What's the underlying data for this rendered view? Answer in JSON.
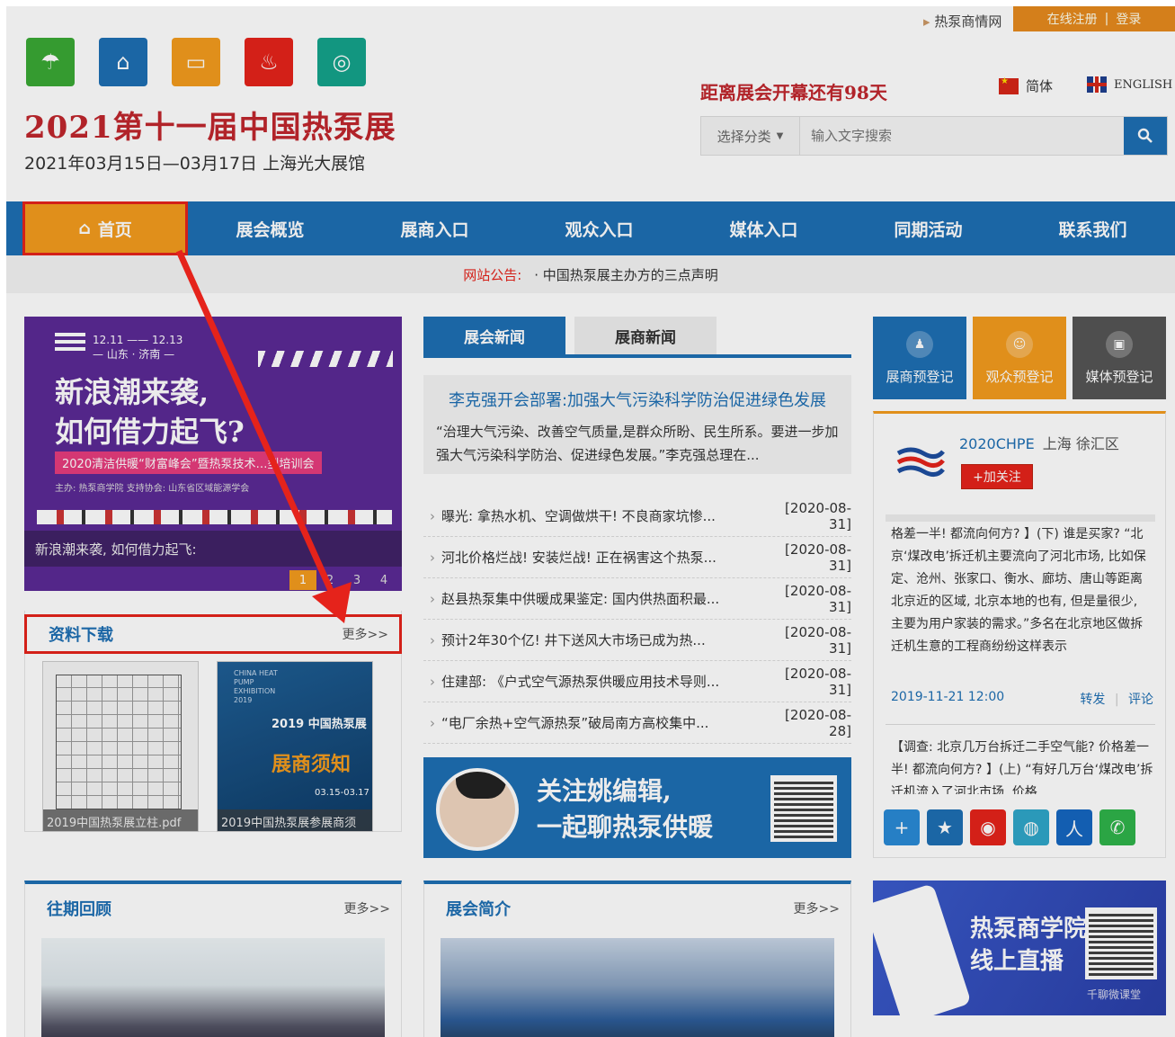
{
  "top": {
    "net_link": "热泵商情网",
    "register": "在线注册",
    "sep": "|",
    "login": "登录"
  },
  "logo_icons": [
    {
      "name": "umbrella-icon",
      "glyph": "☂",
      "color": "#3aa935"
    },
    {
      "name": "house-icon",
      "glyph": "⌂",
      "color": "#1e6fb4"
    },
    {
      "name": "card-icon",
      "glyph": "▭",
      "color": "#f49c1e"
    },
    {
      "name": "flame-icon",
      "glyph": "♨",
      "color": "#e5231b"
    },
    {
      "name": "link-icon",
      "glyph": "◎",
      "color": "#14a38b"
    }
  ],
  "header": {
    "title": "2021第十一届中国热泵展",
    "subtitle": "2021年03月15日—03月17日 上海光大展馆",
    "countdown": "距离展会开幕还有98天",
    "lang_cn": "简体",
    "lang_en": "ENGLISH"
  },
  "search": {
    "category": "选择分类",
    "placeholder": "输入文字搜索"
  },
  "nav": {
    "home": "首页",
    "items": [
      "展会概览",
      "展商入口",
      "观众入口",
      "媒体入口",
      "同期活动",
      "联系我们"
    ]
  },
  "notice": {
    "label": "网站公告:",
    "text": "· 中国热泵展主办方的三点声明"
  },
  "banner": {
    "date_line1": "12.11 —— 12.13",
    "date_line2": "— 山东 · 济南 —",
    "headline1": "新浪潮来袭,",
    "headline2": "如何借力起飞?",
    "tag": "2020清洁供暖“财富峰会”暨热泵技术…型培训会",
    "org": "主办: 热泵商学院    支持协会: 山东省区域能源学会",
    "caption": "新浪潮来袭, 如何借力起飞:",
    "pages": [
      "1",
      "2",
      "3",
      "4"
    ]
  },
  "downloads": {
    "title": "资料下载",
    "more": "更多>>",
    "items": [
      "2019中国热泵展立柱.pdf",
      "2019中国热泵展参展商须"
    ],
    "expo_text": {
      "en": "CHINA HEAT PUMP EXHIBITION 2019",
      "cn": "2019 中国热泵展",
      "notice": "展商须知",
      "date": "03.15-03.17"
    }
  },
  "news_tabs": [
    "展会新闻",
    "展商新闻"
  ],
  "featured": {
    "title": "李克强开会部署:加强大气污染科学防治促进绿色发展",
    "excerpt": "“治理大气污染、改善空气质量,是群众所盼、民生所系。要进一步加强大气污染科学防治、促进绿色发展。”李克强总理在..."
  },
  "news": [
    {
      "title": "曝光: 拿热水机、空调做烘干! 不良商家坑惨...",
      "date": "[2020-08-31]"
    },
    {
      "title": "河北价格烂战! 安装烂战! 正在祸害这个热泵...",
      "date": "[2020-08-31]"
    },
    {
      "title": "赵县热泵集中供暖成果鉴定: 国内供热面积最...",
      "date": "[2020-08-31]"
    },
    {
      "title": "预计2年30个亿! 井下送风大市场已成为热...",
      "date": "[2020-08-31]"
    },
    {
      "title": "住建部: 《户式空气源热泵供暖应用技术导则...",
      "date": "[2020-08-31]"
    },
    {
      "title": "“电厂余热+空气源热泵”破局南方高校集中...",
      "date": "[2020-08-28]"
    }
  ],
  "promo": {
    "line1": "关注姚编辑,",
    "line2": "一起聊热泵供暖"
  },
  "register": [
    {
      "label": "展商预登记",
      "icon": "exhibitor-icon",
      "color": "#1e6fb4"
    },
    {
      "label": "观众预登记",
      "icon": "visitor-icon",
      "color": "#f49c1e"
    },
    {
      "label": "媒体预登记",
      "icon": "media-icon",
      "color": "#555555"
    }
  ],
  "weibo": {
    "name": "2020CHPE",
    "location": "上海 徐汇区",
    "follow": "+加关注",
    "post": "格差一半! 都流向何方? 】(下) 谁是买家? “北京‘煤改电’拆迁机主要流向了河北市场, 比如保定、沧州、张家口、衡水、廊坊、唐山等距离北京近的区域, 北京本地的也有, 但是量很少, 主要为用户家装的需求。”多名在北京地区做拆迁机生意的工程商纷纷这样表示",
    "time": "2019-11-21 12:00",
    "forward": "转发",
    "comment": "评论",
    "post2": "【调查: 北京几万台拆迁二手空气能? 价格差一半! 都流向何方? 】(上) “有好几万台‘煤改电’拆迁机流入了河北市场, 价格"
  },
  "shares": [
    {
      "name": "share-plus-icon",
      "glyph": "+",
      "color": "#2a8ad6"
    },
    {
      "name": "share-qzone-icon",
      "glyph": "★",
      "color": "#1e6fb4"
    },
    {
      "name": "share-weibo-icon",
      "glyph": "◉",
      "color": "#e5231b"
    },
    {
      "name": "share-tencent-icon",
      "glyph": "◍",
      "color": "#2fa6c9"
    },
    {
      "name": "share-renren-icon",
      "glyph": "人",
      "color": "#1566c0"
    },
    {
      "name": "share-wechat-icon",
      "glyph": "✆",
      "color": "#2fb34a"
    }
  ],
  "review": {
    "title": "往期回顾",
    "more": "更多>>"
  },
  "intro": {
    "title": "展会简介",
    "more": "更多>>"
  },
  "app": {
    "line1": "热泵商学院",
    "line2": "线上直播",
    "small": "千聊微课堂"
  }
}
